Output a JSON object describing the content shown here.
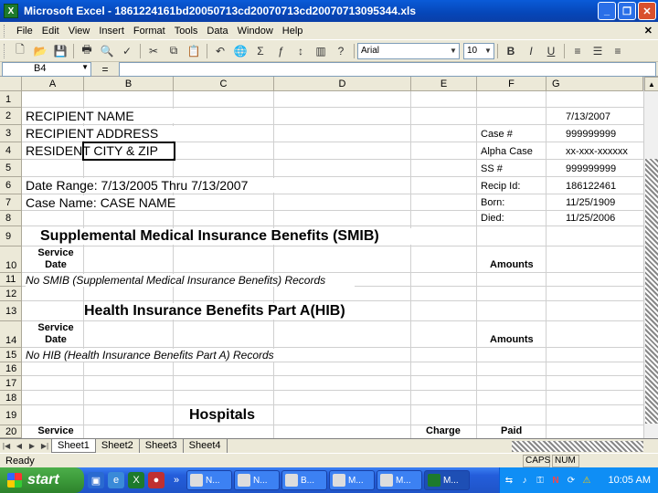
{
  "window": {
    "title": "Microsoft Excel - 1861224161bd20050713cd20070713cd20070713095344.xls",
    "app_icon": "X",
    "buttons": [
      "_",
      "❐",
      "✕"
    ]
  },
  "menu": [
    "File",
    "Edit",
    "View",
    "Insert",
    "Format",
    "Tools",
    "Data",
    "Window",
    "Help"
  ],
  "toolbar": {
    "font": "Arial",
    "size": "10",
    "icons": [
      "new-icon",
      "open-icon",
      "save-icon",
      "print-icon",
      "print-preview-icon",
      "spelling-icon",
      "cut-icon",
      "copy-icon",
      "paste-icon",
      "undo-icon",
      "hyperlink-icon",
      "autosum-icon",
      "function-icon",
      "sort-icon",
      "chart-icon",
      "help-icon",
      "align-left-icon",
      "align-center-icon",
      "align-right-icon"
    ]
  },
  "formula_bar": {
    "name_box": "B4",
    "fx_label": "=",
    "value": ""
  },
  "columns": [
    "A",
    "B",
    "C",
    "D",
    "E",
    "F",
    "G"
  ],
  "rows": [
    "1",
    "2",
    "3",
    "4",
    "5",
    "6",
    "7",
    "8",
    "9",
    "10",
    "11",
    "12",
    "13",
    "14",
    "15",
    "16",
    "17",
    "18",
    "19",
    "20"
  ],
  "cells": {
    "recipient_name": "RECIPIENT NAME",
    "recipient_address": "RECIPIENT ADDRESS",
    "resident_city": "RESIDENT CITY & ZIP",
    "date_range": "Date Range: 7/13/2005 Thru 7/13/2007",
    "case_name": "Case Name: CASE NAME",
    "smib_title": "Supplemental Medical Insurance Benefits (SMIB)",
    "service_date_1a": "Service",
    "service_date_1b": "Date",
    "amounts_1": "Amounts",
    "no_smib": "No SMIB (Supplemental Medical Insurance Benefits) Records",
    "hib_title": "Health Insurance Benefits Part A(HIB)",
    "service_date_2a": "Service",
    "service_date_2b": "Date",
    "amounts_2": "Amounts",
    "no_hib": "No HIB (Health Insurance Benefits Part A) Records",
    "hospitals_title": "Hospitals",
    "service_3": "Service",
    "charge": "Charge",
    "paid": "Paid",
    "labels": [
      "Case #",
      "Alpha Case",
      "SS #",
      "Recip Id:",
      "Born:",
      "Died:"
    ],
    "values": [
      "7/13/2007",
      "999999999",
      "xx-xxx-xxxxxx",
      "999999999",
      "186122461",
      "11/25/1909",
      "11/25/2006"
    ]
  },
  "sheets": [
    "Sheet1",
    "Sheet2",
    "Sheet3",
    "Sheet4"
  ],
  "status": {
    "ready": "Ready",
    "caps": "CAPS",
    "num": "NUM"
  },
  "taskbar": {
    "start": "start",
    "quick_launch_more": "»",
    "tasks": [
      "N...",
      "N...",
      "B...",
      "M...",
      "M...",
      "M..."
    ],
    "tray_icons": [
      "network-icon",
      "volume-icon",
      "security-icon",
      "antivirus-icon",
      "update-icon",
      "alert-icon"
    ],
    "clock": "10:05 AM"
  }
}
